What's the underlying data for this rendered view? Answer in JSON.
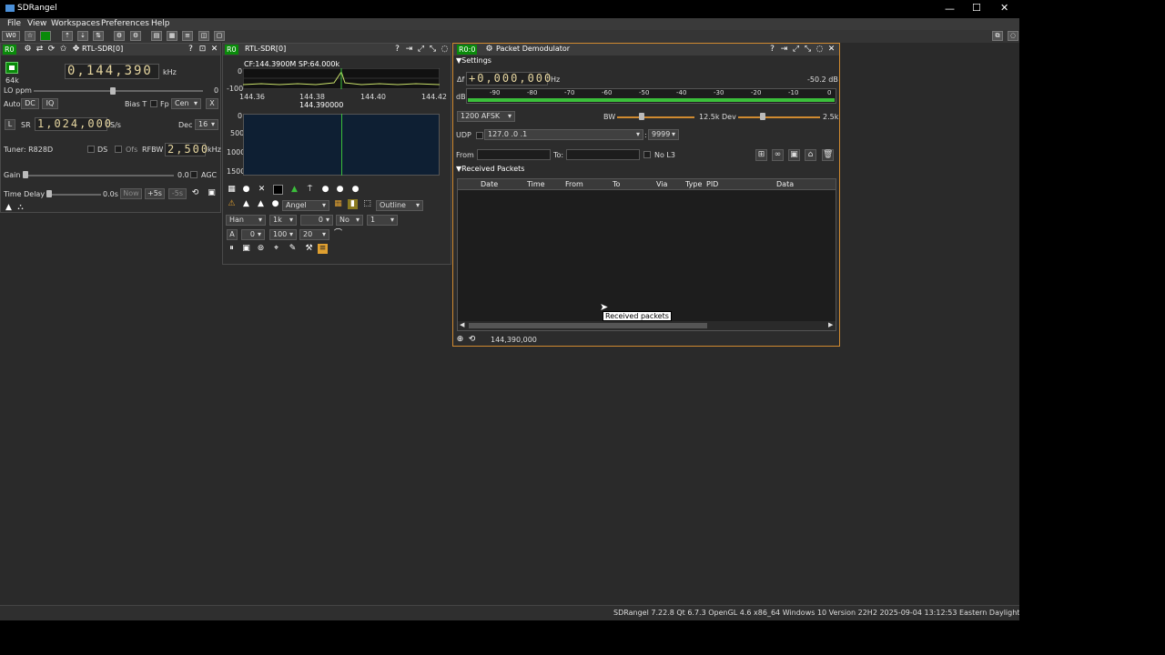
{
  "app": {
    "title": "SDRangel"
  },
  "menu": {
    "file": "File",
    "view": "View",
    "workspaces": "Workspaces",
    "preferences": "Preferences",
    "help": "Help"
  },
  "toolbar": {
    "workspace": "W0"
  },
  "device": {
    "badge": "R0",
    "title": "RTL-SDR[0]",
    "freq": "0,144,390",
    "freq_unit": "kHz",
    "rate": "64k",
    "lo_ppm_label": "LO ppm",
    "lo_ppm_value": "0",
    "auto": "Auto",
    "dc": "DC",
    "iq": "IQ",
    "bias_t": "Bias T",
    "fp": "Fp",
    "fp_combo": "Cen",
    "x_btn": "X",
    "l_btn": "L",
    "sr_label": "SR",
    "sr_value": "1,024,000",
    "sr_unit": "S/s",
    "dec_label": "Dec",
    "dec_value": "16",
    "tuner": "Tuner: R828D",
    "ds": "DS",
    "ofs": "Ofs",
    "rfbw_label": "RFBW",
    "rfbw_value": "2,500",
    "rfbw_unit": "kHz",
    "gain_label": "Gain",
    "gain_value": "0.0",
    "agc": "AGC",
    "time_delay_label": "Time Delay",
    "time_delay_value": "0.0s",
    "now": "Now",
    "plus5": "+5s",
    "minus5": "-5s"
  },
  "spectrum": {
    "badge": "R0",
    "title": "RTL-SDR[0]",
    "cf": "CF:144.3900M SP:64.000k",
    "y0": "0",
    "y100": "-100",
    "x1": "144.36",
    "x2": "144.38",
    "x3": "144.40",
    "x4": "144.42",
    "marker": "144.390000",
    "wf0": "0",
    "wf500": "500",
    "wf1000": "1000",
    "wf1500": "1500",
    "palette": "Angel",
    "mode": "Outline",
    "window": "Han",
    "fft": "1k",
    "overlap": "0",
    "avg_mode": "No",
    "avg": "1",
    "a_label": "A",
    "ref": "0",
    "range": "100",
    "rate": "20"
  },
  "demod": {
    "badge": "R0:0",
    "title": "Packet Demodulator",
    "settings": "Settings",
    "df_label": "Δf",
    "df_value": "+0,000,000",
    "df_unit": "Hz",
    "level": "-50.2 dB",
    "db_label": "dB",
    "scale": [
      "-90",
      "-80",
      "-70",
      "-60",
      "-50",
      "-40",
      "-30",
      "-20",
      "-10",
      "0"
    ],
    "modulation": "1200 AFSK",
    "bw_label": "BW",
    "bw_value": "12.5k",
    "dev_label": "Dev",
    "dev_value": "2.5k",
    "udp_label": "UDP",
    "udp_addr": "127.0 .0 .1",
    "udp_port": "9999",
    "from_label": "From",
    "to_label": "To:",
    "nol3": "No L3",
    "received": "Received Packets",
    "columns": [
      "Date",
      "Time",
      "From",
      "To",
      "Via",
      "Type",
      "PID",
      "Data"
    ],
    "tooltip": "Received packets",
    "frequency": "144,390,000"
  },
  "status": {
    "text": "SDRangel 7.22.8 Qt 6.7.3 OpenGL 4.6 x86_64 Windows 10 Version 22H2 2025-09-04 13:12:53 Eastern Daylight Time"
  },
  "colors": {
    "accent": "#0a8a0a",
    "meter": "#3bbf3b",
    "trace": "#c8e06a"
  }
}
